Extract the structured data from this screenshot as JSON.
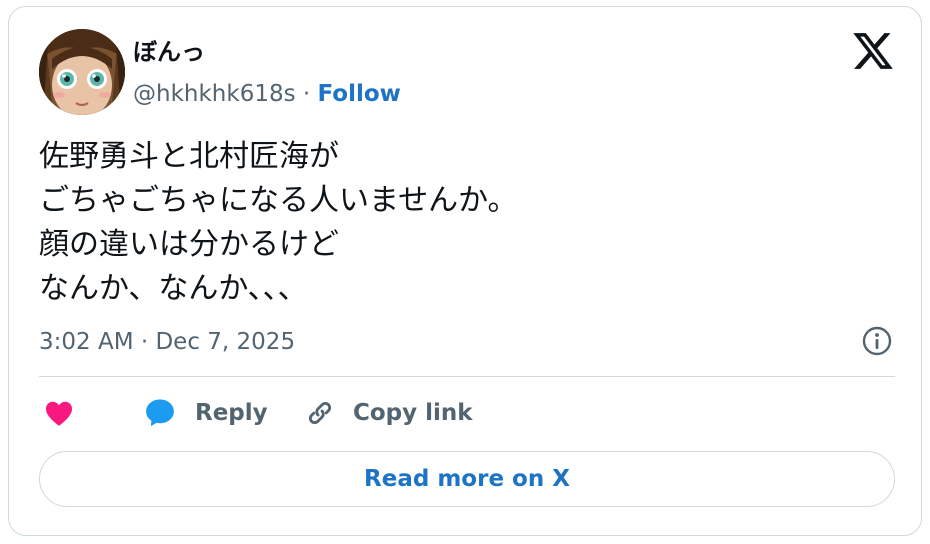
{
  "author": {
    "name": "ぼんっ",
    "handle": "@hkhkhk618s",
    "separator": "·",
    "follow_label": "Follow"
  },
  "tweet": {
    "lines": [
      "佐野勇斗と北村匠海が",
      "ごちゃごちゃになる人いませんか。",
      "顔の違いは分かるけど",
      "なんか、なんか､､､"
    ],
    "timestamp": "3:02 AM · Dec 7, 2025"
  },
  "actions": {
    "like_icon": "heart-icon",
    "reply_label": "Reply",
    "reply_icon": "speech-bubble-icon",
    "copy_link_label": "Copy link",
    "copy_link_icon": "link-icon"
  },
  "read_more_label": "Read more on X",
  "colors": {
    "accent": "#1d74c4",
    "like": "#f91880",
    "reply": "#1d9bf0",
    "muted": "#536471",
    "text": "#0f1419",
    "border": "#cfd9de"
  }
}
